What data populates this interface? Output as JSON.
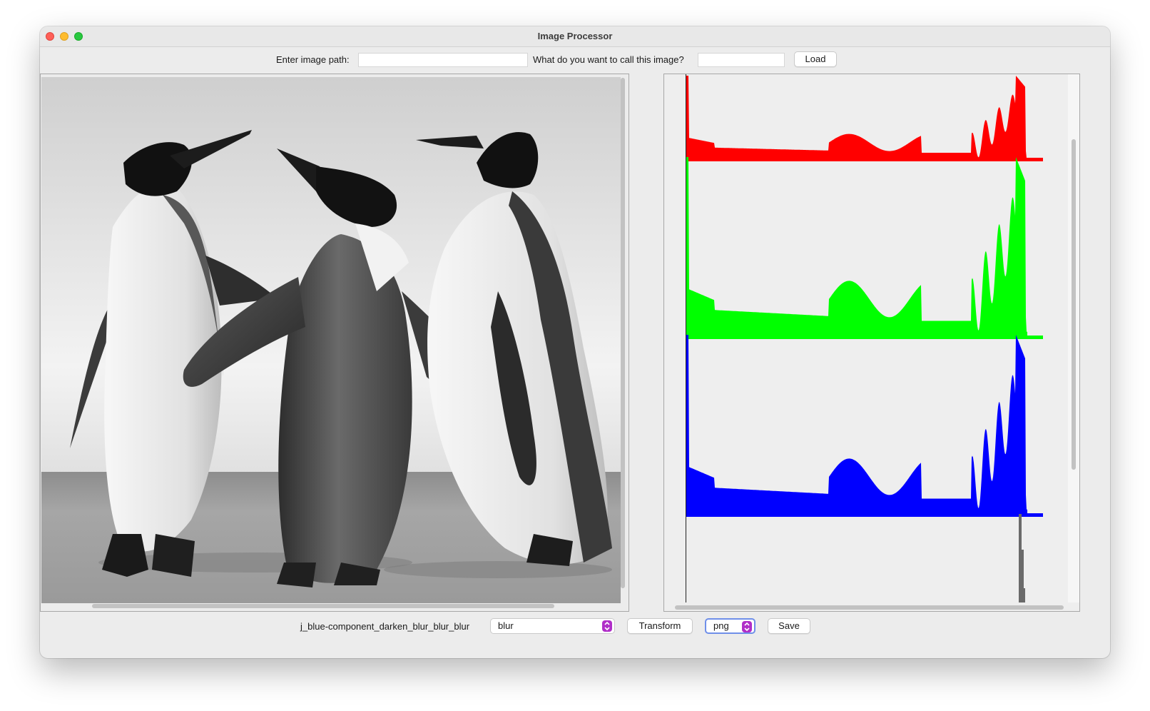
{
  "window": {
    "title": "Image Processor"
  },
  "top_bar": {
    "path_label": "Enter image path:",
    "path_value": "",
    "name_label": "What do you want to call this image?",
    "name_value": "",
    "load_label": "Load"
  },
  "bottom_bar": {
    "image_name": "j_blue-component_darken_blur_blur_blur",
    "transform_select": "blur",
    "transform_label": "Transform",
    "format_select": "png",
    "save_label": "Save"
  },
  "colors": {
    "red_channel": "#ff0000",
    "green_channel": "#00ff00",
    "blue_channel": "#0000ff",
    "intensity_channel": "#6a6a6a",
    "select_accent": "#b02ec8"
  },
  "icons": {
    "close": "traffic-close-icon",
    "minimize": "traffic-minimize-icon",
    "maximize": "traffic-maximize-icon",
    "select": "updown-chevron-icon"
  }
}
